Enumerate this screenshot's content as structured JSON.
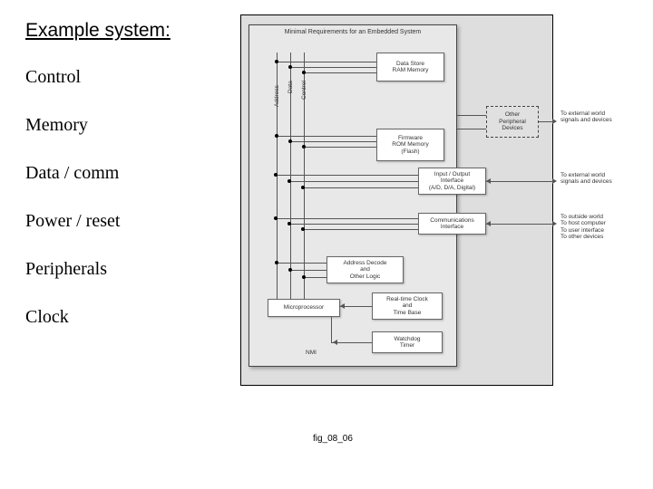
{
  "left": {
    "title": "Example system:",
    "items": [
      "Control",
      "Memory",
      "Data / comm",
      "Power / reset",
      "Peripherals",
      "Clock"
    ]
  },
  "figure_label": "fig_08_06",
  "diagram": {
    "title": "Minimal Requirements for an Embedded System",
    "buses": [
      "Address",
      "Data",
      "Control"
    ],
    "blocks": {
      "ram": "Data Store\nRAM Memory",
      "rom": "Firmware\nROM Memory\n(Flash)",
      "io": "Input / Output\nInterface\n(A/D, D/A, Digital)",
      "comm": "Communications\nInterface",
      "decode": "Address Decode\nand\nOther Logic",
      "cpu": "Microprocessor",
      "rtc": "Real-time Clock\nand\nTime Base",
      "wdt": "Watchdog\nTimer",
      "periph": "Other\nPeripheral\nDevices",
      "nmi": "NMI"
    },
    "external": {
      "periph": "To external world\nsignals and devices",
      "io": "To external world\nsignals and devices",
      "comm": "To outside world\nTo host computer\nTo user interface\nTo other devices"
    }
  }
}
